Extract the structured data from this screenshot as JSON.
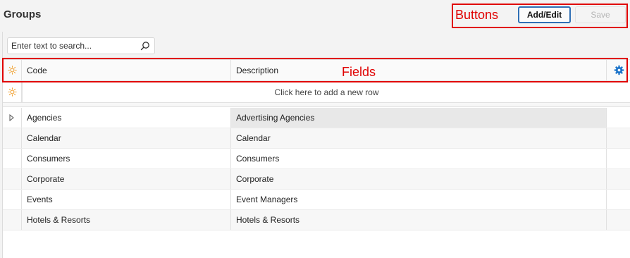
{
  "header": {
    "title": "Groups",
    "add_edit_label": "Add/Edit",
    "save_label": "Save"
  },
  "annotations": {
    "buttons_label": "Buttons",
    "fields_label": "Fields",
    "color": "#e00000"
  },
  "search": {
    "placeholder": "Enter text to search..."
  },
  "grid": {
    "columns": [
      "Code",
      "Description"
    ],
    "new_row_text": "Click here to add a new row",
    "rows": [
      {
        "code": "Agencies",
        "description": "Advertising Agencies"
      },
      {
        "code": "Calendar",
        "description": "Calendar"
      },
      {
        "code": "Consumers",
        "description": "Consumers"
      },
      {
        "code": "Corporate",
        "description": "Corporate"
      },
      {
        "code": "Events",
        "description": "Event Managers"
      },
      {
        "code": "Hotels & Resorts",
        "description": "Hotels & Resorts"
      }
    ]
  },
  "colors": {
    "accent": "#2f6fb5",
    "settings_icon": "#1a73c9",
    "new_row_icon": "#f0a030"
  },
  "icons": {
    "search": "search-icon",
    "new_row": "sun-icon",
    "settings": "gear-icon",
    "current_row": "chevron-right-icon"
  }
}
